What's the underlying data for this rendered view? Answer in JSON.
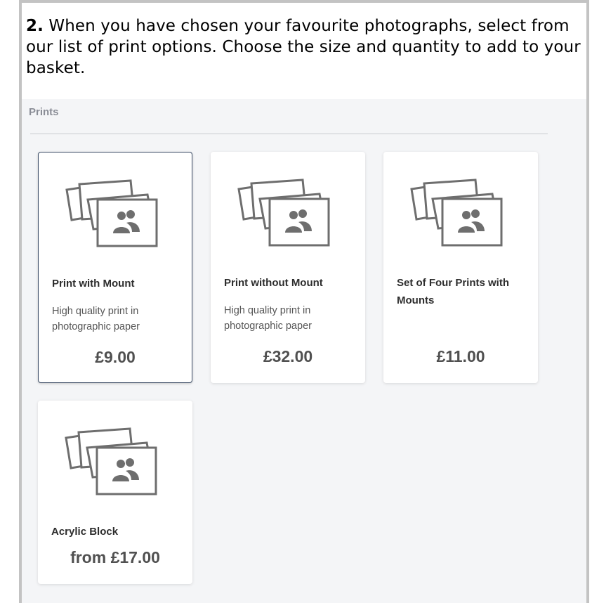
{
  "instruction": {
    "number": "2.",
    "text": " When you have chosen your favourite photographs, select from our list of print options. Choose the size and quantity to add to your basket."
  },
  "section": {
    "label": "Prints"
  },
  "cards": [
    {
      "title": "Print with Mount",
      "description": "High quality print in photographic paper",
      "price": "£9.00",
      "selected": true
    },
    {
      "title": "Print without Mount",
      "description": "High quality print in photographic paper",
      "price": "£32.00",
      "selected": false
    },
    {
      "title": "Set of Four Prints with Mounts",
      "description": "",
      "price": "£11.00",
      "selected": false
    },
    {
      "title": "Acrylic Block",
      "description": "",
      "price": "from £17.00",
      "selected": false
    }
  ],
  "colors": {
    "selected_border": "#3e4e68",
    "icon_stroke": "#6e6e6e",
    "background": "#f4f5f7"
  },
  "icons": {
    "product_thumbnail": "photo-prints-icon"
  }
}
